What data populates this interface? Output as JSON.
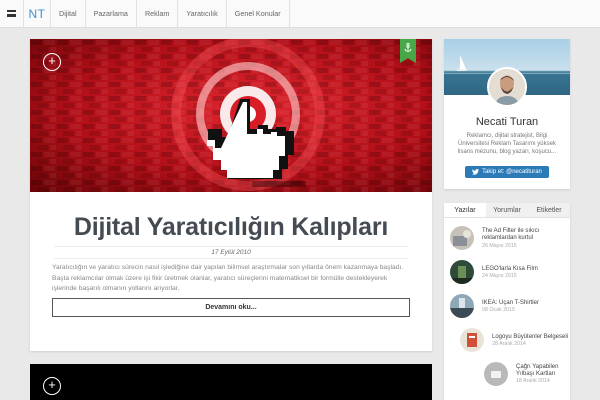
{
  "nav": {
    "logo": "NT",
    "items": [
      {
        "label": "Dijital"
      },
      {
        "label": "Pazarlama"
      },
      {
        "label": "Reklam"
      },
      {
        "label": "Yaratıcılık"
      },
      {
        "label": "Genel Konular"
      }
    ]
  },
  "post": {
    "title": "Dijital Yaratıcılığın Kalıpları",
    "date": "17 Eylül 2010",
    "excerpt": "Yaratıcılığın ve yaratıcı sürecin nasıl işlediğine dair yapılan bilimsel araştırmalar son yıllarda önem kazanmaya başladı. Başta reklamcılar olmak üzere işi fikir üretmek olanlar, yaratıcı süreçlerini matematiksel bir formülle destekleyerek işlerinde başarılı olmanın yollarını arıyorlar.",
    "read_more": "Devamını oku...",
    "hero_icons": {
      "plus": "plus-circle-icon",
      "ribbon": "anchor-icon"
    }
  },
  "profile": {
    "name": "Necati Turan",
    "bio": "Reklamcı, dijital stratejist, Bilgi Üniversitesi Reklam Tasarımı yüksek lisans mezunu, blog yazarı, koşucu...",
    "twitter_label": "Takip et: @necatituran"
  },
  "tabs": {
    "labels": [
      "Yazılar",
      "Yorumlar",
      "Etiketler"
    ],
    "active": "Yazılar",
    "items": [
      {
        "title": "The Ad Filter ile sıkıcı reklamlardan kurtul",
        "date": "26 Mayıs 2015"
      },
      {
        "title": "LEGO'larla Kısa Film",
        "date": "24 Mayıs 2015"
      },
      {
        "title": "IKEA: Uçan T-Shirtler",
        "date": "08 Ocak 2015"
      },
      {
        "title": "Logoyu Büyütenler Belgeseli",
        "date": "28 Aralık 2014"
      },
      {
        "title": "Çağrı Yapabilen Yılbaşı Kartları",
        "date": "18 Aralık 2014"
      }
    ]
  },
  "colors": {
    "accent": "#3d8fd6",
    "hero_red": "#c8141e",
    "ribbon_green": "#48a848",
    "twitter": "#2b7bb9"
  }
}
